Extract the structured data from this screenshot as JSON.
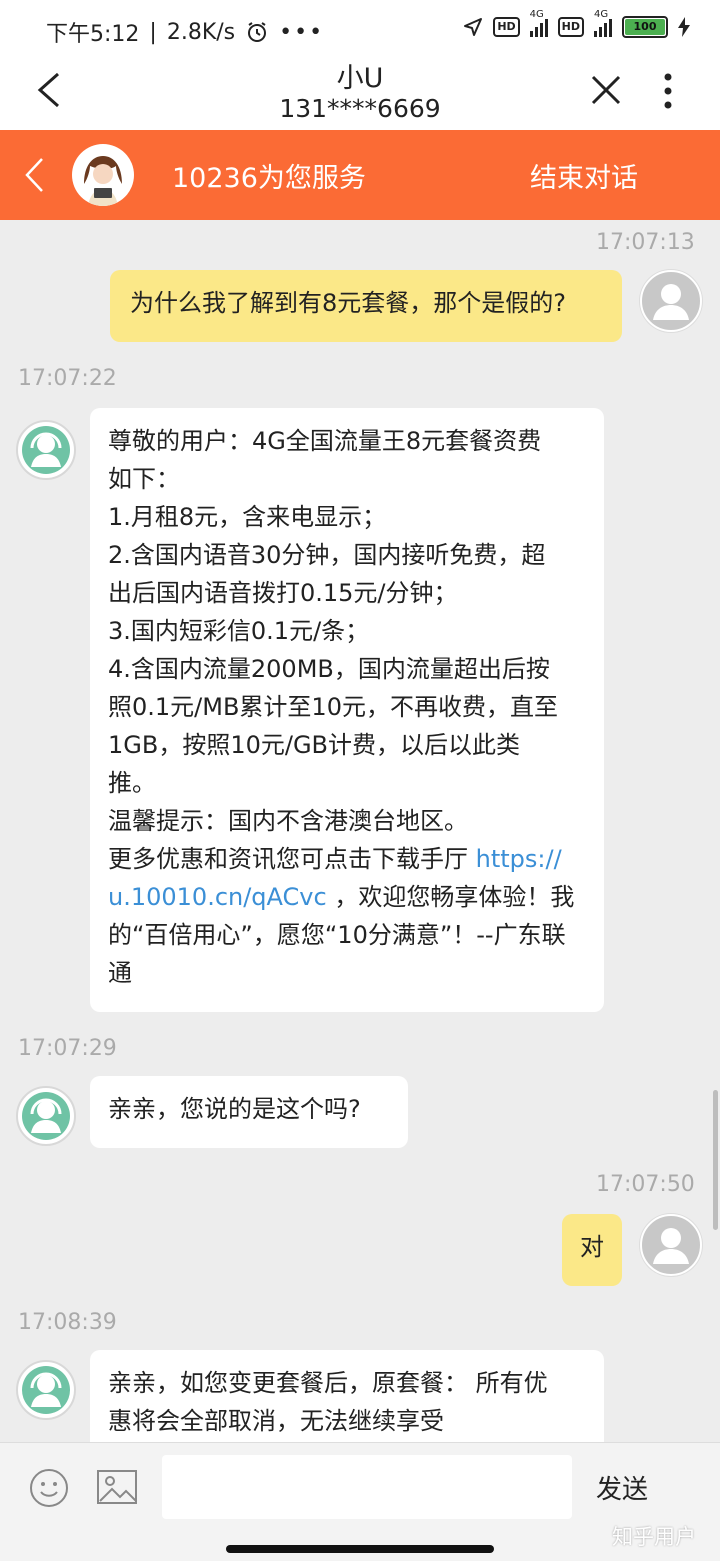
{
  "status": {
    "time": "下午5:12",
    "speed": "2.8K/s",
    "net1": "4G",
    "net2": "4G",
    "hd": "HD",
    "battery": "100"
  },
  "header": {
    "contact_name": "小U",
    "phone": "131****6669"
  },
  "service": {
    "title": "10236为您服务",
    "end_label": "结束对话"
  },
  "chat": {
    "ts1": "17:07:13",
    "msg1": "为什么我了解到有8元套餐，那个是假的?",
    "ts2": "17:07:22",
    "msg2": {
      "l1": "尊敬的用户：4G全国流量王8元套餐资费",
      "l2": "如下：",
      "l3": "1.月租8元，含来电显示；",
      "l4": "2.含国内语音30分钟，国内接听免费，超",
      "l5": "出后国内语音拨打0.15元/分钟；",
      "l6": "3.国内短彩信0.1元/条；",
      "l7": "4.含国内流量200MB，国内流量超出后按",
      "l8": "照0.1元/MB累计至10元，不再收费，直至",
      "l9": "1GB，按照10元/GB计费，以后以此类",
      "l10": "推。",
      "l11": "温馨提示：国内不含港澳台地区。",
      "l12": "更多优惠和资讯您可点击下载手厅 ",
      "link1": "https://",
      "link2": "u.10010.cn/qACvc",
      "l13": " ，欢迎您畅享体验！我",
      "l14": "的“百倍用心”，愿您“10分满意”！--广东联",
      "l15": "通"
    },
    "ts3": "17:07:29",
    "msg3": "亲亲，您说的是这个吗?",
    "ts4": "17:07:50",
    "msg4": "对",
    "ts5": "17:08:39",
    "msg5": {
      "l1": "亲亲，如您变更套餐后，原套餐： 所有优",
      "l2": "惠将会全部取消，无法继续享受"
    }
  },
  "input": {
    "placeholder": "",
    "send_label": "发送"
  },
  "watermark": "知乎用户",
  "colors": {
    "accent": "#fb6b35",
    "my_bubble": "#fbe888",
    "link": "#3b8fd6"
  }
}
